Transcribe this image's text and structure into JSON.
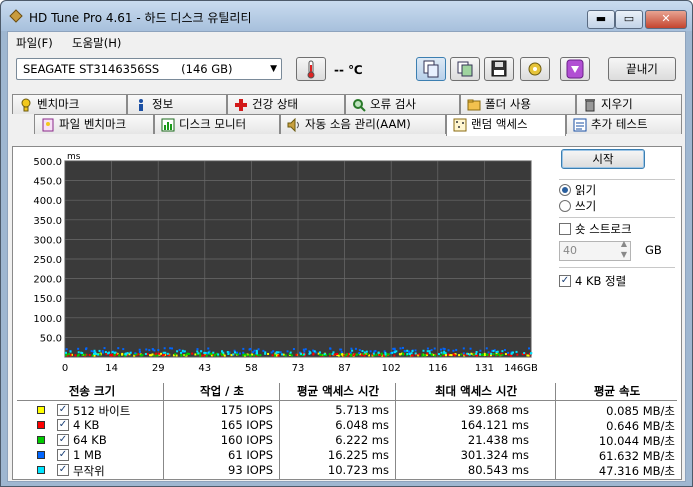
{
  "window": {
    "title": "HD Tune Pro 4.61 - 하드 디스크 유틸리티",
    "min_label": "▬",
    "max_label": "▭",
    "close_label": "✕"
  },
  "menu": [
    {
      "label": "파일(F)"
    },
    {
      "label": "도움말(H)"
    }
  ],
  "toolbar": {
    "drive": "SEAGATE ST3146356SS      (146 GB)",
    "temperature": "-- ℃",
    "exit_label": "끝내기"
  },
  "tabs_top": [
    {
      "label": "벤치마크",
      "icon": "benchmark-icon"
    },
    {
      "label": "정보",
      "icon": "info-icon"
    },
    {
      "label": "건강 상태",
      "icon": "health-icon"
    },
    {
      "label": "오류 검사",
      "icon": "error-scan-icon"
    },
    {
      "label": "폴더 사용",
      "icon": "folder-usage-icon"
    },
    {
      "label": "지우기",
      "icon": "erase-icon"
    }
  ],
  "tabs_bottom": [
    {
      "label": "파일 벤치마크",
      "icon": "file-benchmark-icon"
    },
    {
      "label": "디스크 모니터",
      "icon": "disk-monitor-icon"
    },
    {
      "label": "자동 소음 관리(AAM)",
      "icon": "aam-icon"
    },
    {
      "label": "랜덤 액세스",
      "icon": "random-access-icon"
    },
    {
      "label": "추가 테스트",
      "icon": "extra-tests-icon"
    }
  ],
  "controls": {
    "start_label": "시작",
    "read_label": "읽기",
    "write_label": "쓰기",
    "short_stroke_label": "숏 스트로크",
    "short_stroke_value": "40",
    "gb_label": "GB",
    "align_label": "4 KB 정렬"
  },
  "chart_data": {
    "type": "scatter",
    "ylabel": "ms",
    "y_ticks": [
      "500.0",
      "450.0",
      "400.0",
      "350.0",
      "300.0",
      "250.0",
      "200.0",
      "150.0",
      "100.0",
      "50.0"
    ],
    "x_ticks": [
      "0",
      "14",
      "29",
      "43",
      "58",
      "73",
      "87",
      "102",
      "116",
      "131",
      "146GB"
    ],
    "ylim": [
      0,
      500
    ],
    "xlim": [
      0,
      146
    ],
    "grid": true,
    "background": "#3a3a3a",
    "series": [
      {
        "name": "512 바이트",
        "color": "#ffff00",
        "level": 6
      },
      {
        "name": "4 KB",
        "color": "#ff0000",
        "level": 6
      },
      {
        "name": "64 KB",
        "color": "#00cc00",
        "level": 6
      },
      {
        "name": "1 MB",
        "color": "#0066ff",
        "level": 16
      },
      {
        "name": "무작위",
        "color": "#00e5ff",
        "level": 11
      }
    ]
  },
  "table": {
    "headers": [
      "전송 크기",
      "작업 / 초",
      "평균 액세스 시간",
      "최대 액세스 시간",
      "평균 속도"
    ],
    "rows": [
      {
        "name": "512 바이트",
        "color": "#ffff00",
        "iops": "175 IOPS",
        "avg": "5.713 ms",
        "max": "39.868 ms",
        "speed": "0.085 MB/초"
      },
      {
        "name": "4 KB",
        "color": "#ff0000",
        "iops": "165 IOPS",
        "avg": "6.048 ms",
        "max": "164.121 ms",
        "speed": "0.646 MB/초"
      },
      {
        "name": "64 KB",
        "color": "#00cc00",
        "iops": "160 IOPS",
        "avg": "6.222 ms",
        "max": "21.438 ms",
        "speed": "10.044 MB/초"
      },
      {
        "name": "1 MB",
        "color": "#0066ff",
        "iops": "61 IOPS",
        "avg": "16.225 ms",
        "max": "301.324 ms",
        "speed": "61.632 MB/초"
      },
      {
        "name": "무작위",
        "color": "#00e5ff",
        "iops": "93 IOPS",
        "avg": "10.723 ms",
        "max": "80.543 ms",
        "speed": "47.316 MB/초"
      }
    ]
  }
}
